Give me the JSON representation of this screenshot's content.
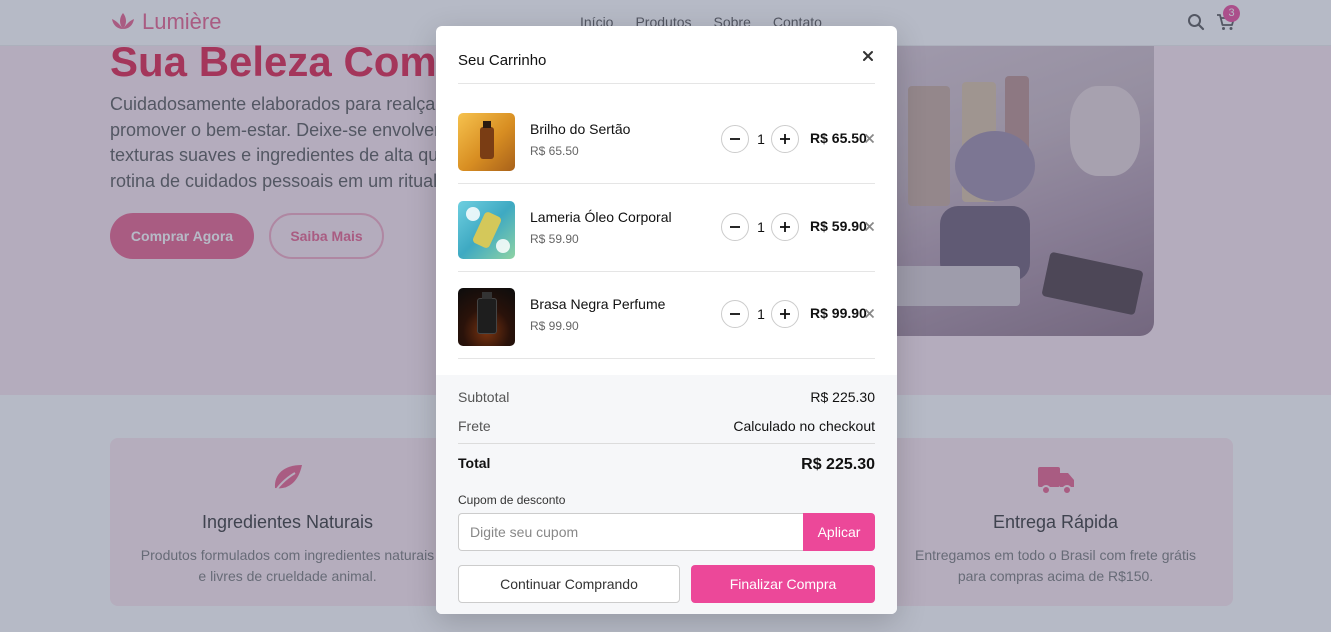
{
  "brand": {
    "name": "Lumière",
    "accent": "#ec4899"
  },
  "nav": {
    "links": [
      "Início",
      "Produtos",
      "Sobre",
      "Contato"
    ],
    "cart_count": "3"
  },
  "hero": {
    "title": "Sua Beleza Com",
    "text_lines": [
      "Cuidadosamente elaborados para realçar",
      "promover o bem-estar. Deixe-se envolver",
      "texturas suaves e ingredientes de alta qua",
      "rotina de cuidados pessoais em um ritual"
    ],
    "primary_button": "Comprar Agora",
    "secondary_button": "Saiba Mais"
  },
  "features": [
    {
      "icon": "leaf-icon",
      "title": "Ingredientes Naturais",
      "lines": [
        "Produtos formulados com ingredientes naturais",
        "e livres de crueldade animal."
      ]
    },
    {
      "icon": "truck-icon",
      "title": "Entrega Rápida",
      "lines": [
        "Entregamos em todo o Brasil com frete grátis",
        "para compras acima de R$150."
      ]
    }
  ],
  "cart": {
    "title": "Seu Carrinho",
    "items": [
      {
        "name": "Brilho do Sertão",
        "unit_price": "R$ 65.50",
        "quantity": "1",
        "total": "R$ 65.50",
        "thumb_colors": [
          "#f0b43a",
          "#c9781c"
        ]
      },
      {
        "name": "Lameria Óleo Corporal",
        "unit_price": "R$ 59.90",
        "quantity": "1",
        "total": "R$ 59.90",
        "thumb_colors": [
          "#5cc4d6",
          "#d8d26a"
        ]
      },
      {
        "name": "Brasa Negra Perfume",
        "unit_price": "R$ 99.90",
        "quantity": "1",
        "total": "R$ 99.90",
        "thumb_colors": [
          "#1a1a1a",
          "#8a3a10"
        ]
      }
    ],
    "summary": {
      "subtotal_label": "Subtotal",
      "subtotal_value": "R$ 225.30",
      "shipping_label": "Frete",
      "shipping_value": "Calculado no checkout",
      "total_label": "Total",
      "total_value": "R$ 225.30"
    },
    "coupon": {
      "label": "Cupom de desconto",
      "placeholder": "Digite seu cupom",
      "apply_label": "Aplicar"
    },
    "continue_label": "Continuar Comprando",
    "checkout_label": "Finalizar Compra"
  }
}
